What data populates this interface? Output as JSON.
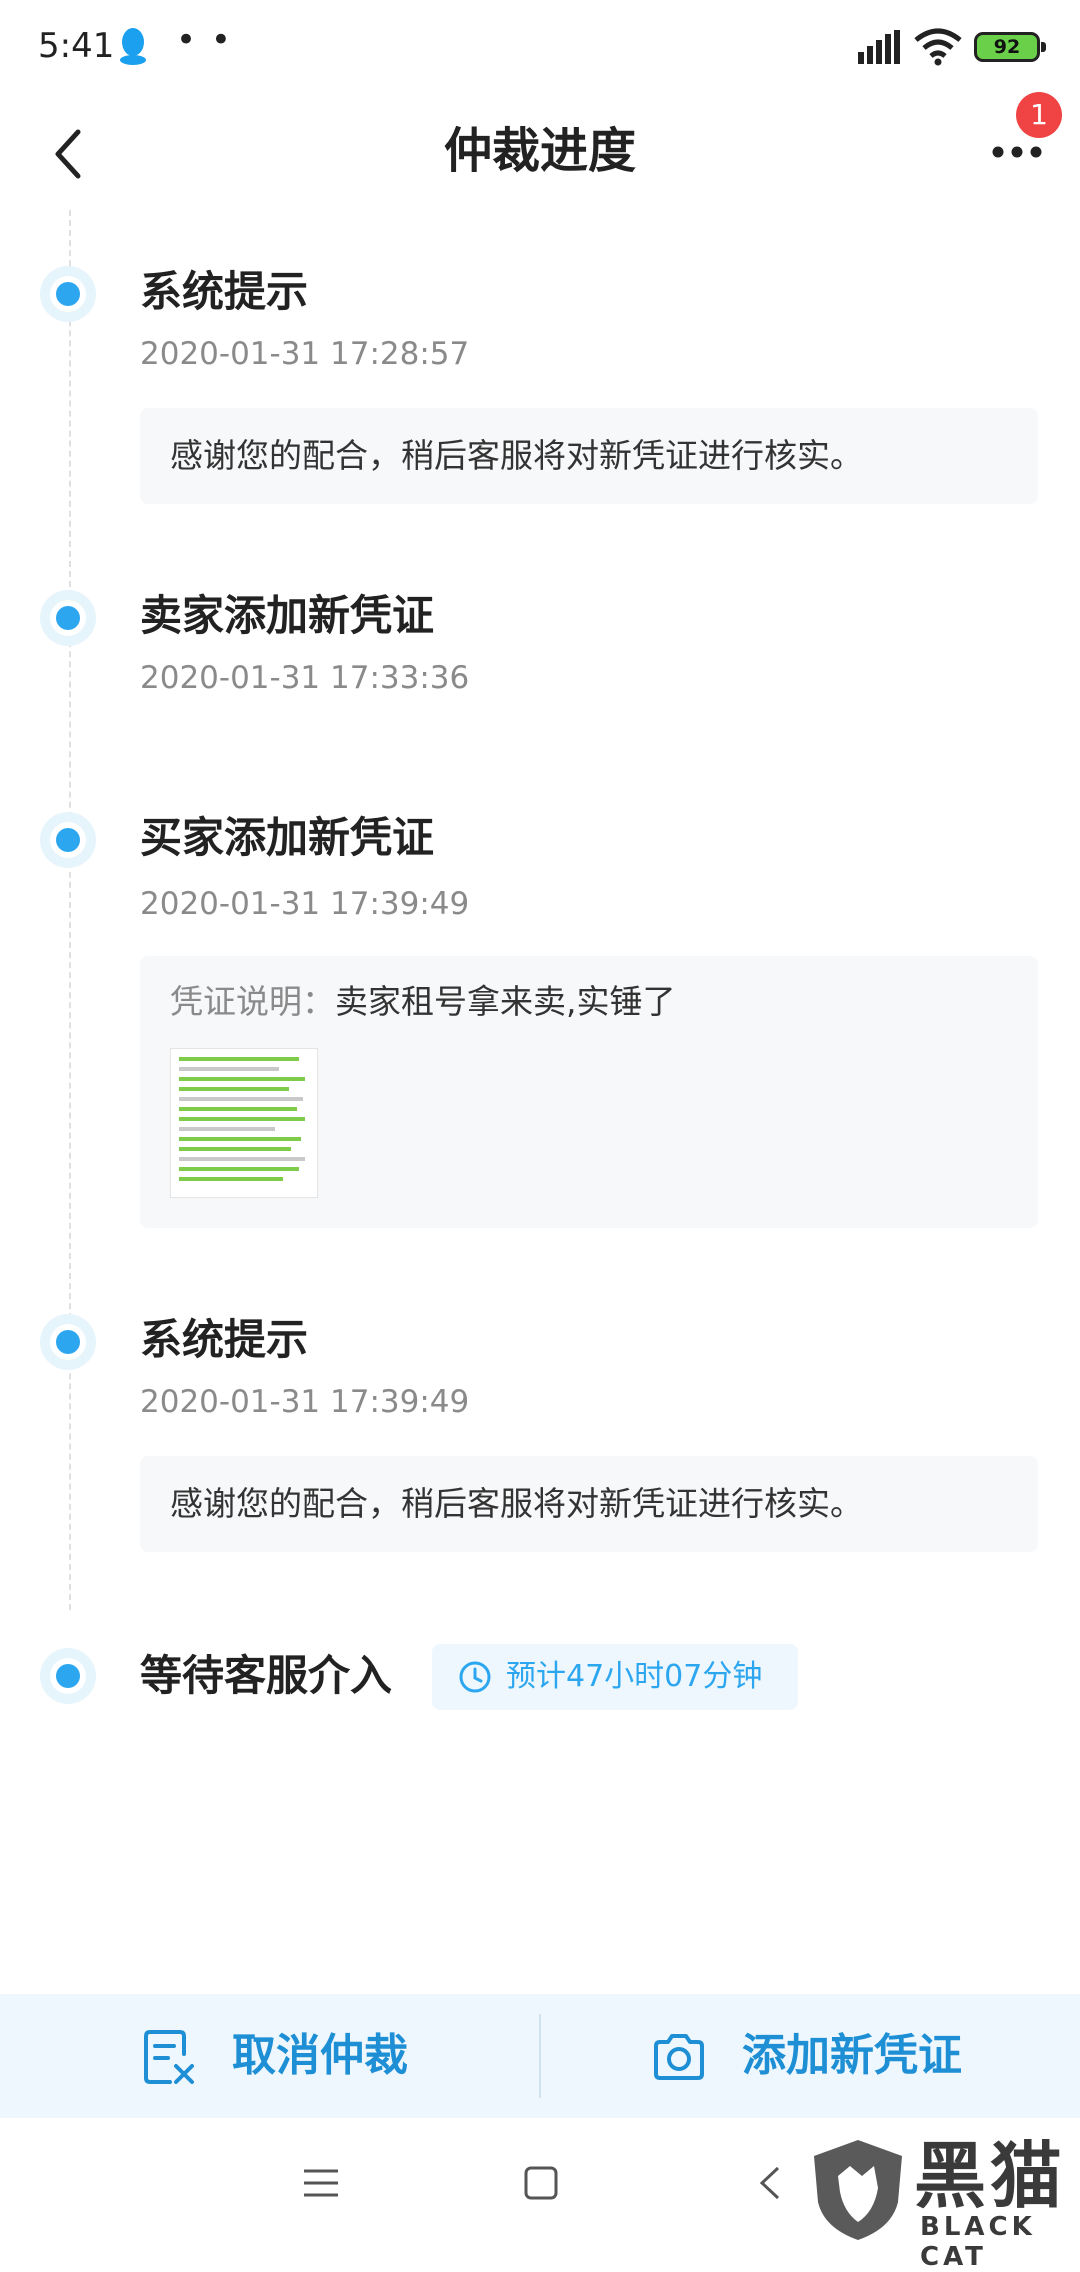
{
  "status_bar": {
    "time": "5:41",
    "battery": "92"
  },
  "nav": {
    "title": "仲裁进度",
    "badge_count": "1"
  },
  "events": [
    {
      "title": "系统提示",
      "time": "2020-01-31 17:28:57",
      "message": "感谢您的配合，稍后客服将对新凭证进行核实。"
    },
    {
      "title": "卖家添加新凭证",
      "time": "2020-01-31 17:33:36"
    },
    {
      "title": "买家添加新凭证",
      "time": "2020-01-31 17:39:49",
      "note_label": "凭证说明：",
      "note_text": "卖家租号拿来卖,实锤了"
    },
    {
      "title": "系统提示",
      "time": "2020-01-31 17:39:49",
      "message": "感谢您的配合，稍后客服将对新凭证进行核实。"
    },
    {
      "title": "等待客服介入",
      "eta": "预计47小时07分钟"
    }
  ],
  "actions": {
    "cancel_label": "取消仲裁",
    "add_label": "添加新凭证"
  },
  "watermark": {
    "title": "黑猫",
    "subtitle": "BLACK CAT"
  },
  "colors": {
    "accent": "#2da6f0",
    "action_text": "#1e8fd4",
    "badge": "#f04343"
  }
}
